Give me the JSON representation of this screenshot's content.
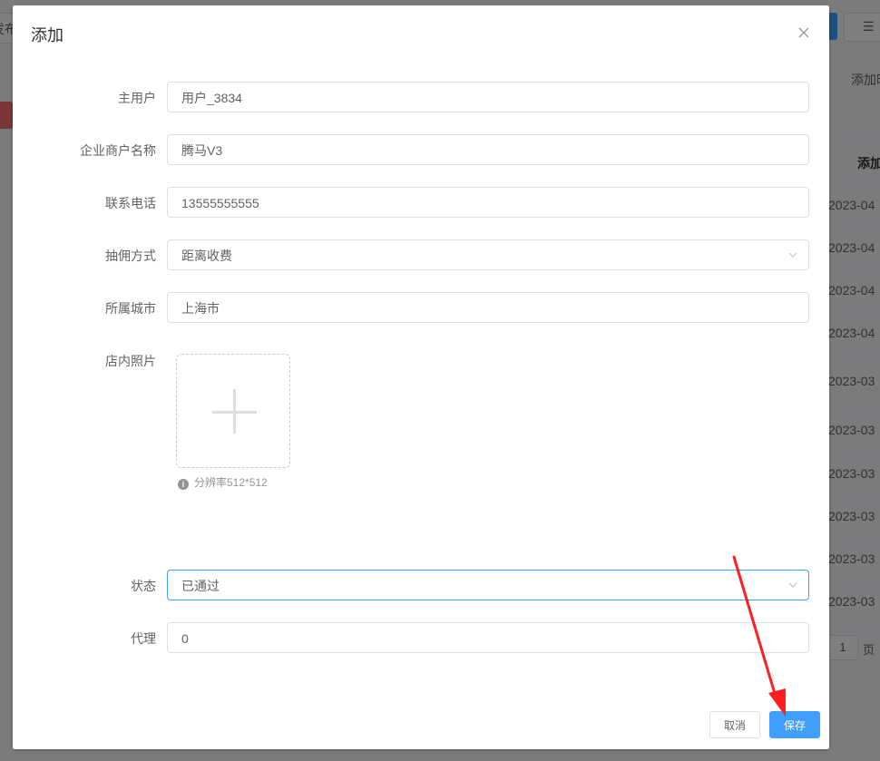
{
  "background": {
    "top_left_label": "发布",
    "list_icon": "list-icon",
    "add_label": "添加时间",
    "column_header": "添加时间",
    "dates": [
      "2023-04",
      "2023-04",
      "2023-04",
      "2023-04",
      "2023-03",
      "2023-03",
      "2023-03",
      "2023-03",
      "2023-03",
      "2023-03"
    ],
    "pager_value": "1",
    "pager_suffix": "页"
  },
  "dialog": {
    "title": "添加",
    "close_icon": "close-icon",
    "fields": {
      "main_user": {
        "label": "主用户",
        "value": "用户_3834"
      },
      "merchant_name": {
        "label": "企业商户名称",
        "value": "腾马V3"
      },
      "phone": {
        "label": "联系电话",
        "value": "13555555555"
      },
      "commission": {
        "label": "抽佣方式",
        "value": "距离收费"
      },
      "city": {
        "label": "所属城市",
        "value": "上海市"
      },
      "photo": {
        "label": "店内照片",
        "hint": "分辨率512*512",
        "hint_icon": "info-icon"
      },
      "status": {
        "label": "状态",
        "value": "已通过"
      },
      "agent": {
        "label": "代理",
        "value": "0"
      }
    },
    "buttons": {
      "cancel": "取消",
      "save": "保存"
    }
  },
  "colors": {
    "primary": "#409eff",
    "annotation_arrow": "#ff1f1f"
  }
}
